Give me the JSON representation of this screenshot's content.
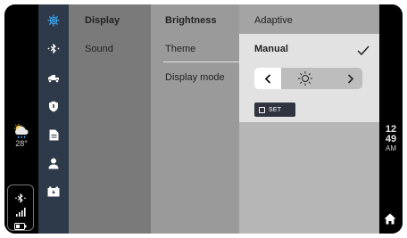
{
  "status_left": {
    "weather_icon": "cloud-sun-rain-icon",
    "temperature": "28°",
    "connection_icons": [
      "bluetooth-icon",
      "signal-bars-icon",
      "battery-icon"
    ]
  },
  "nav_icons": [
    "settings-gear-icon",
    "bluetooth-icon",
    "scooter-icon",
    "shield-icon",
    "document-icon",
    "user-icon",
    "battery-charging-icon"
  ],
  "menu": {
    "level1": [
      {
        "label": "Display",
        "selected": true
      },
      {
        "label": "Sound",
        "selected": false
      }
    ],
    "level2": [
      {
        "label": "Brightness",
        "selected": true
      },
      {
        "label": "Theme",
        "selected": false
      },
      {
        "label": "Display mode",
        "selected": false
      }
    ],
    "level3": {
      "adaptive_label": "Adaptive",
      "manual_label": "Manual",
      "manual_checked_icon": "checkmark-icon"
    }
  },
  "brightness_slider": {
    "decrease_icon": "chevron-left-icon",
    "level_icon": "sun-icon",
    "increase_icon": "chevron-right-icon"
  },
  "set_button": {
    "label": "SET"
  },
  "clock": {
    "hour": "12",
    "minute": "49",
    "ampm": "AM"
  },
  "home_icon": "home-icon",
  "colors": {
    "accent": "#3da9f5",
    "nav_bg": "#2e3a49",
    "set_button_bg": "#2f3440"
  }
}
